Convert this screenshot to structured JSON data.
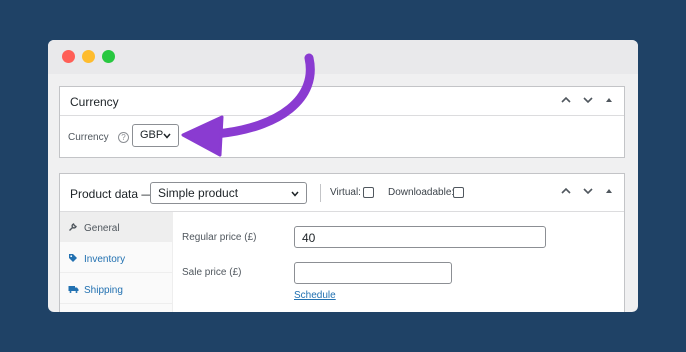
{
  "currency_box": {
    "title": "Currency",
    "field_label": "Currency",
    "help_glyph": "?",
    "selected": "GBP"
  },
  "product_box": {
    "title": "Product data —",
    "product_type": "Simple product",
    "virtual_label": "Virtual:",
    "downloadable_label": "Downloadable:",
    "tabs": [
      {
        "label": "General",
        "icon": "wrench-icon"
      },
      {
        "label": "Inventory",
        "icon": "tag-icon"
      },
      {
        "label": "Shipping",
        "icon": "truck-icon"
      }
    ],
    "regular_price_label": "Regular price (£)",
    "regular_price_value": "40",
    "sale_price_label": "Sale price (£)",
    "sale_price_value": "",
    "schedule_link": "Schedule"
  },
  "colors": {
    "background": "#1f4266",
    "arrow": "#8a3bd1",
    "link": "#2271b1"
  }
}
